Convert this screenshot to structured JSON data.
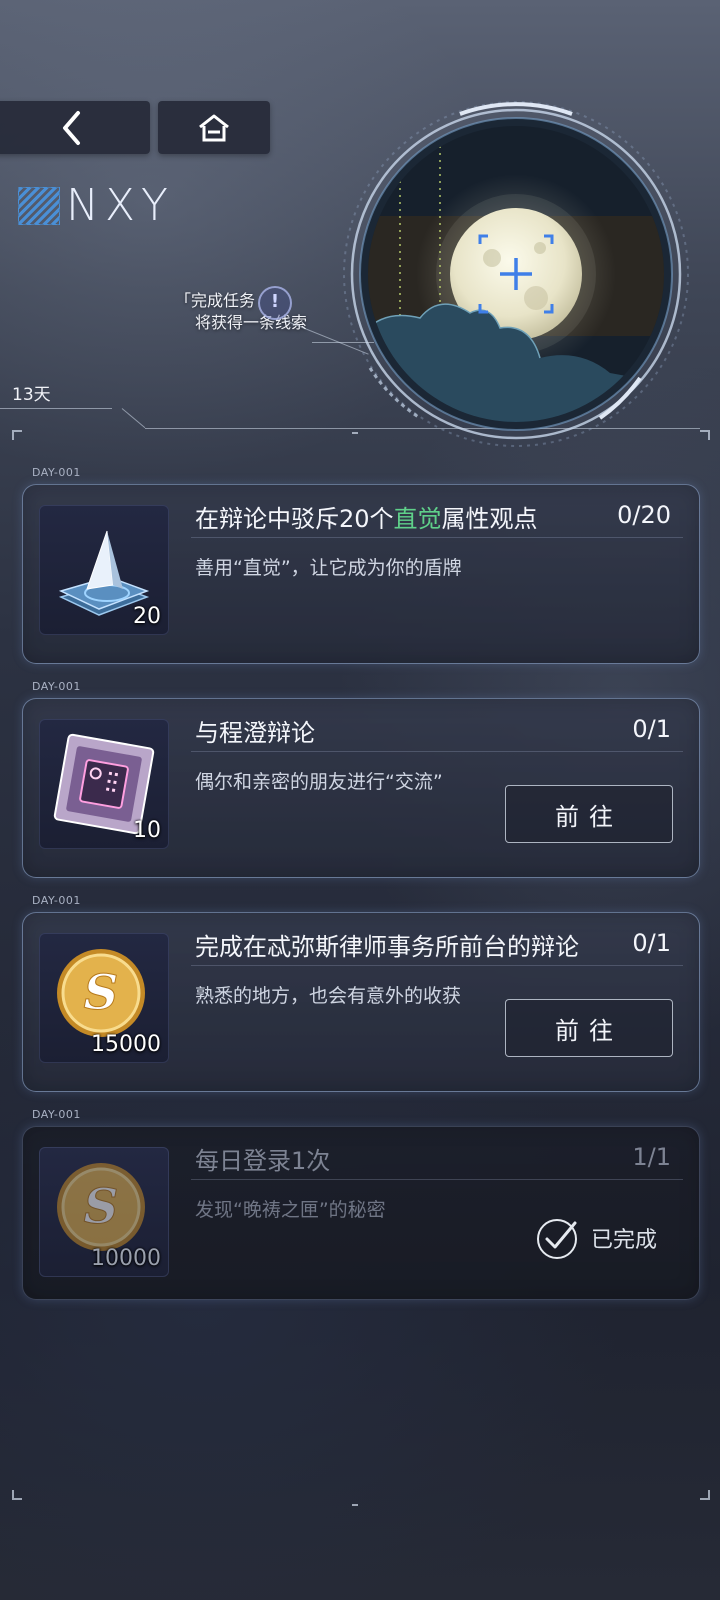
{
  "nav": {
    "back_icon": "chevron-left-icon",
    "home_icon": "home-icon"
  },
  "logo": {
    "text": "NXY"
  },
  "hint": {
    "line1": "「完成任务",
    "line2": "将获得一条线索",
    "marker": "!"
  },
  "days_left": "13天",
  "tasks": [
    {
      "day_tag": "DAY-001",
      "title_pre": "在辩论中驳斥20个",
      "title_hl": "直觉",
      "title_post": "属性观点",
      "progress": "0/20",
      "desc": "善用“直觉”，让它成为你的盾牌",
      "reward_qty": "20",
      "reward_icon": "prism-card-icon",
      "button": null
    },
    {
      "day_tag": "DAY-001",
      "title": "与程澄辩论",
      "progress": "0/1",
      "desc": "偶尔和亲密的朋友进行“交流”",
      "reward_qty": "10",
      "reward_icon": "chip-card-icon",
      "button": "前往"
    },
    {
      "day_tag": "DAY-001",
      "title": "完成在忒弥斯律师事务所前台的辩论",
      "progress": "0/1",
      "desc": "熟悉的地方，也会有意外的收获",
      "reward_qty": "15000",
      "reward_icon": "gold-coin-icon",
      "button": "前往"
    },
    {
      "day_tag": "DAY-001",
      "title": "每日登录1次",
      "progress": "1/1",
      "desc": "发现“晚祷之匣”的秘密",
      "reward_qty": "10000",
      "reward_icon": "gold-coin-icon",
      "status": "已完成"
    }
  ],
  "colors": {
    "highlight": "#5fd08a",
    "accent_blue": "#4a8fd6",
    "coin_gold": "#d9a640"
  }
}
